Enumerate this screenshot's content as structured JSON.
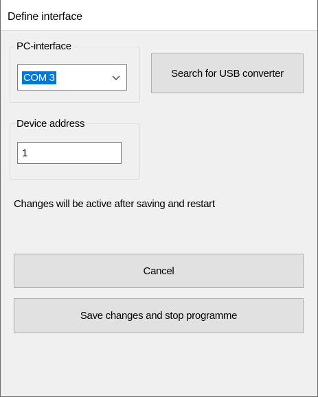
{
  "window": {
    "title": "Define interface"
  },
  "pc_interface": {
    "group_label": "PC-interface",
    "selected_value": "COM 3",
    "arrow_icon": "chevron-down-icon"
  },
  "search_button": {
    "label": "Search for USB converter"
  },
  "device_address": {
    "group_label": "Device address",
    "value": "1"
  },
  "info_text": "Changes will be active after saving and restart",
  "buttons": {
    "cancel_label": "Cancel",
    "save_label": "Save changes and stop programme"
  },
  "colors": {
    "selection": "#0078d7",
    "button_face": "#e1e1e1",
    "window_bg": "#f0f0f0"
  }
}
